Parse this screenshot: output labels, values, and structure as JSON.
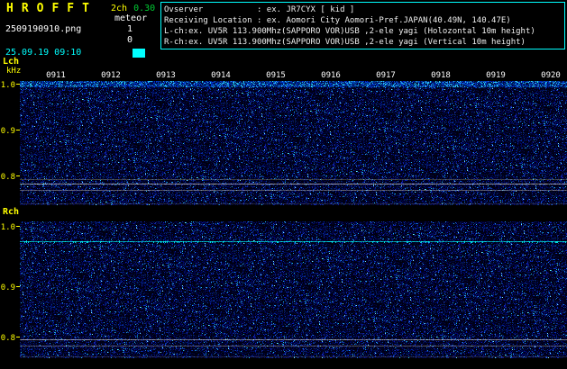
{
  "header": {
    "app_title": "HROFFT",
    "channel_mode": "2ch",
    "version": "0.30",
    "filename": "2509190910.png",
    "meteor_label": "meteor",
    "meteor_count_lch": "1",
    "meteor_count_rch": "0",
    "datetime": "25.09.19 09:10",
    "info_box": {
      "observer": "Ovserver           : ex. JR7CYX [ kid ]",
      "location": "Receiving Location : ex. Aomori City Aomori-Pref.JAPAN(40.49N, 140.47E)",
      "lch": "L-ch:ex. UV5R 113.900Mhz(SAPPORO VOR)USB ,2-ele yagi (Holozontal 10m height)",
      "rch": "R-ch:ex. UV5R 113.900Mhz(SAPPORO VOR)USB ,2-ele yagi (Vertical 10m height)"
    }
  },
  "colors": {
    "title_yellow": "#ffff00",
    "version_green": "#00cc33",
    "datetime_cyan": "#00ffff",
    "info_border_cyan": "#00ffff",
    "axis_yellow": "#ffff00",
    "time_label_white": "#ffffff",
    "noise_blue": "#0000aa",
    "signal_cyan": "#00ffff"
  },
  "spectrogram": {
    "time_labels": [
      "0911",
      "0912",
      "0913",
      "0914",
      "0915",
      "0916",
      "0917",
      "0918",
      "0919",
      "0920"
    ],
    "panels": [
      {
        "id": "lch",
        "label": "Lch",
        "unit": "kHz",
        "ticks": [
          "1.0",
          "0.9",
          "0.8"
        ],
        "top_band_rows": 7,
        "lines": [
          {
            "y": 109,
            "color": [
              200,
              200,
              130
            ],
            "alpha": 0.4
          },
          {
            "y": 114,
            "color": [
              235,
              235,
              235
            ],
            "alpha": 0.75
          },
          {
            "y": 121,
            "color": [
              205,
              205,
              205
            ],
            "alpha": 0.55
          },
          {
            "y": 136,
            "color": [
              140,
              140,
              140
            ],
            "alpha": 0.3
          }
        ]
      },
      {
        "id": "rch",
        "label": "Rch",
        "unit": "",
        "ticks": [
          "1.0",
          "0.9",
          "0.8"
        ],
        "top_band_rows": 0,
        "lines": [
          {
            "y": 22,
            "color": [
              0,
              240,
              240
            ],
            "alpha": 0.9,
            "sparkle": true
          },
          {
            "y": 131,
            "color": [
              235,
              235,
              235
            ],
            "alpha": 0.7
          },
          {
            "y": 138,
            "color": [
              200,
              200,
              200
            ],
            "alpha": 0.5
          },
          {
            "y": 150,
            "color": [
              140,
              140,
              140
            ],
            "alpha": 0.3
          }
        ]
      }
    ]
  },
  "chart_data": {
    "type": "heatmap",
    "title": "HROFFT 2ch radio meteor spectrogram 25.09.19 09:10-09:20",
    "x_ticks": [
      "0911",
      "0912",
      "0913",
      "0914",
      "0915",
      "0916",
      "0917",
      "0918",
      "0919",
      "0920"
    ],
    "y_ticks_khz": [
      1.0,
      0.9,
      0.8
    ],
    "ylabel": "kHz",
    "panels": [
      {
        "channel": "Lch",
        "meteor_count": 1,
        "signals": [
          {
            "kind": "carrier-lines",
            "freq_khz": [
              0.79,
              0.77
            ],
            "appearance": "two faint horizontal white lines just below the 0.8 kHz tick"
          },
          {
            "kind": "noise-band",
            "freq_khz": 1.0,
            "appearance": "brighter blue noise band along the top edge of the panel"
          }
        ]
      },
      {
        "channel": "Rch",
        "meteor_count": 0,
        "signals": [
          {
            "kind": "continuous-tone",
            "freq_khz": 0.97,
            "appearance": "bright cyan horizontal line across full width"
          },
          {
            "kind": "carrier-lines",
            "freq_khz": [
              0.81,
              0.8
            ],
            "appearance": "two faint horizontal white lines near the 0.8 kHz tick"
          }
        ]
      }
    ],
    "background": "dark blue random noise speckle"
  }
}
